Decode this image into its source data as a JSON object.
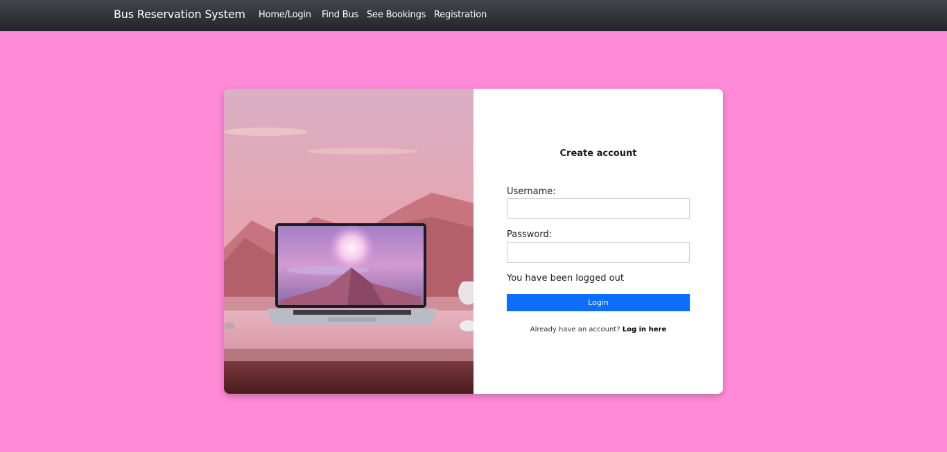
{
  "navbar": {
    "brand": "Bus Reservation System",
    "links": [
      {
        "label": "Home/Login"
      },
      {
        "label": "Find Bus"
      },
      {
        "label": "See Bookings"
      },
      {
        "label": "Registration"
      }
    ]
  },
  "colors": {
    "page_background": "#ff8ad8",
    "navbar": "#2b2e32",
    "primary_button": "#0d6efd"
  },
  "form": {
    "title": "Create account",
    "username_label": "Username:",
    "username_value": "",
    "password_label": "Password:",
    "password_value": "",
    "status_message": "You have been logged out",
    "login_button": "Login",
    "already_text": "Already have an account?",
    "login_link": "Log in here"
  }
}
